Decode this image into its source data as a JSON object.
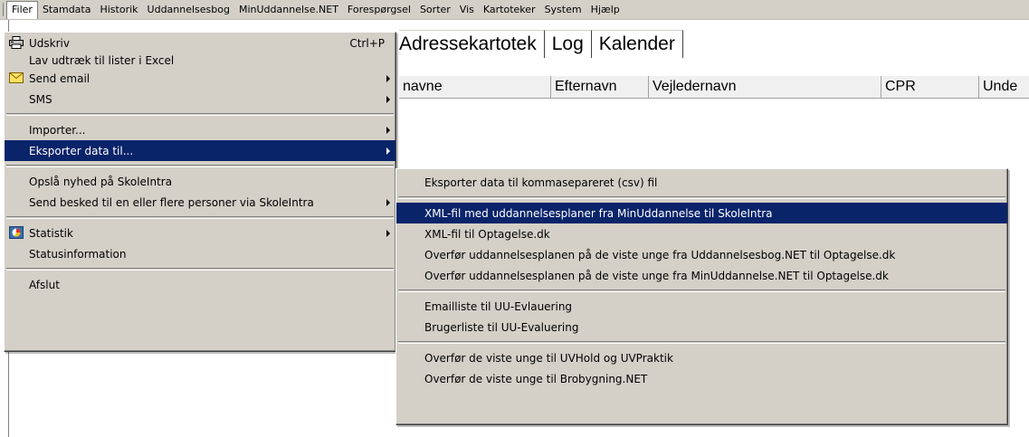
{
  "menubar": {
    "items": [
      "Filer",
      "Stamdata",
      "Historik",
      "Uddannelsesbog",
      "MinUddannelse.NET",
      "Forespørgsel",
      "Sorter",
      "Vis",
      "Kartoteker",
      "System",
      "Hjælp"
    ]
  },
  "background": {
    "tabs": [
      "Adressekartotek",
      "Log",
      "Kalender"
    ],
    "columns": [
      "navne",
      "Efternavn",
      "Vejledernavn",
      "CPR",
      "Unde"
    ]
  },
  "filer_menu": {
    "print": "Udskriv",
    "print_shortcut": "Ctrl+P",
    "excel": "Lav udtræk til lister i Excel",
    "email": "Send email",
    "sms": "SMS",
    "import": "Importer...",
    "export": "Eksporter data til...",
    "news": "Opslå nyhed på SkoleIntra",
    "message": "Send besked til en eller flere personer via SkoleIntra",
    "stats": "Statistik",
    "status": "Statusinformation",
    "quit": "Afslut"
  },
  "export_menu": {
    "csv": "Eksporter data til kommasepareret (csv) fil",
    "xml_skoleintra": "XML-fil med uddannelsesplaner fra MinUddannelse til SkoleIntra",
    "xml_optagelse": "XML-fil til Optagelse.dk",
    "transfer_ub": "Overfør uddannelsesplanen på de viste unge fra Uddannelsesbog.NET til Optagelse.dk",
    "transfer_mu": "Overfør uddannelsesplanen på de viste unge fra MinUddannelse.NET til Optagelse.dk",
    "emaillist": "Emailliste til UU-Evlauering",
    "userlist": "Brugerliste til UU-Evaluering",
    "uvhold": "Overfør de viste unge til UVHold og UVPraktik",
    "brobygning": "Overfør de viste unge til Brobygning.NET"
  },
  "colors": {
    "menu_bg": "#d4d0c8",
    "highlight": "#0a246a"
  }
}
